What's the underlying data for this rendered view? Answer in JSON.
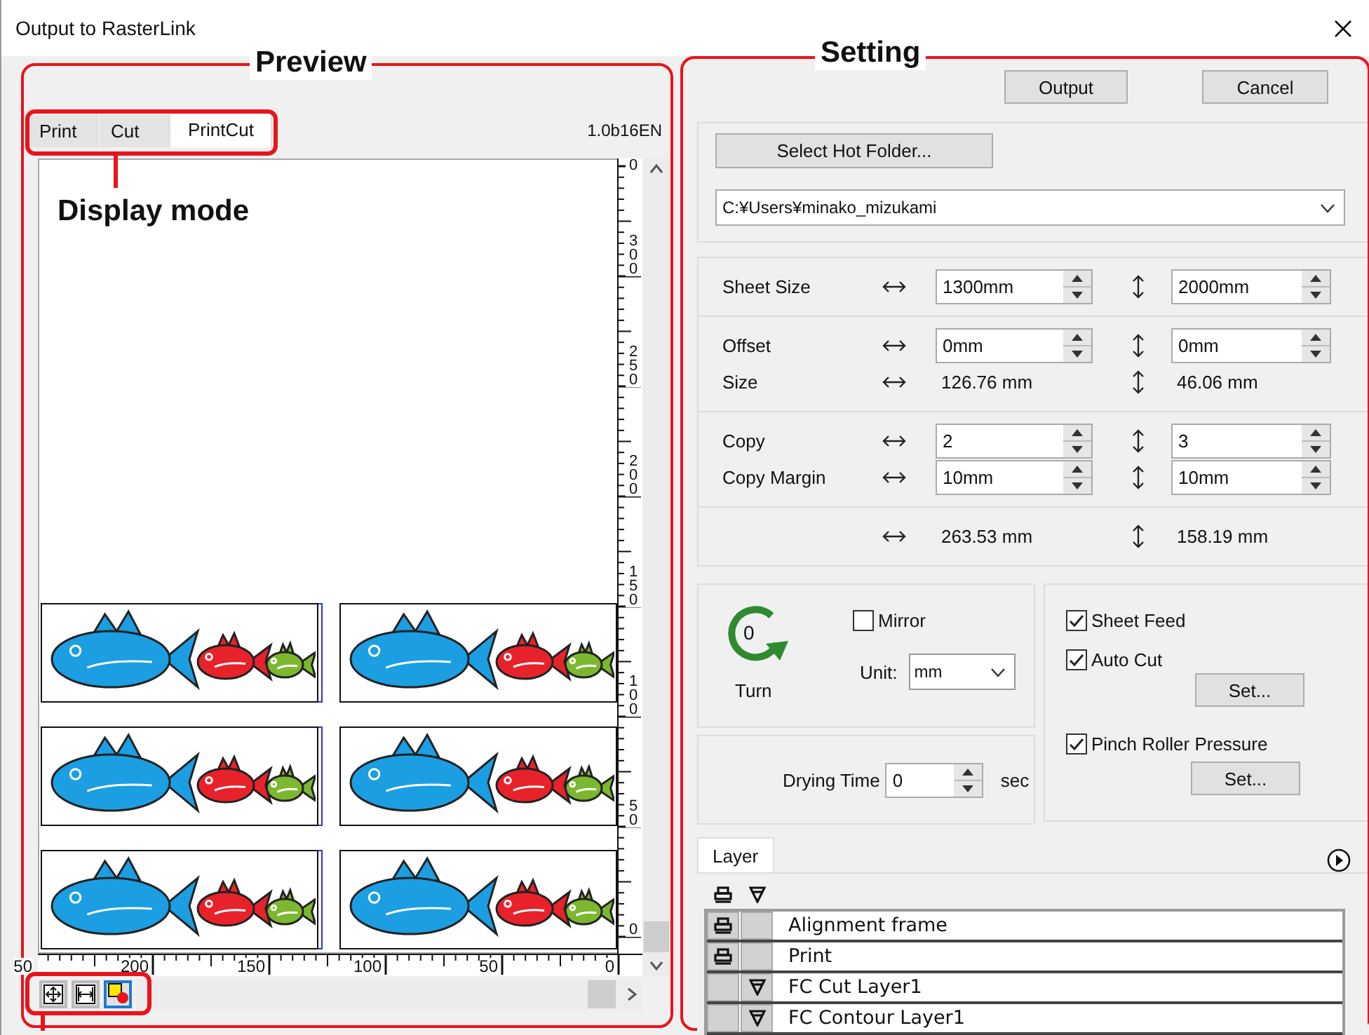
{
  "window": {
    "title": "Output to RasterLink"
  },
  "annotations": {
    "preview": "Preview",
    "setting": "Setting",
    "display_mode": "Display mode"
  },
  "preview": {
    "tabs": [
      {
        "label": "Print",
        "selected": false
      },
      {
        "label": "Cut",
        "selected": false
      },
      {
        "label": "PrintCut",
        "selected": true
      }
    ],
    "version": "1.0b16EN",
    "vertical_ruler": [
      "0",
      "300",
      "250",
      "200",
      "150",
      "100",
      "50",
      "0"
    ],
    "horizontal_ruler": [
      "50",
      "200",
      "150",
      "100",
      "50",
      "0"
    ],
    "view_buttons": [
      {
        "kind": "fit",
        "selected": false
      },
      {
        "kind": "width",
        "selected": false
      },
      {
        "kind": "color",
        "selected": true
      }
    ]
  },
  "setting": {
    "buttons": [
      "Output",
      "Cancel"
    ],
    "hot_folder_button": "Select Hot Folder...",
    "hot_folder_path": "C:¥Users¥minako_mizukami",
    "sheet_groups": [
      [
        {
          "kind": "field",
          "label": "Sheet Size",
          "h": "1300mm",
          "v": "2000mm"
        }
      ],
      [
        {
          "kind": "field",
          "label": "Offset",
          "h": "0mm",
          "v": "0mm"
        },
        {
          "kind": "text",
          "label": "Size",
          "h": "126.76 mm",
          "v": "46.06 mm"
        }
      ],
      [
        {
          "kind": "field",
          "label": "Copy",
          "h": "2",
          "v": "3"
        },
        {
          "kind": "field",
          "label": "Copy Margin",
          "h": "10mm",
          "v": "10mm"
        }
      ],
      [
        {
          "kind": "text",
          "h": "263.53 mm",
          "v": "158.19 mm"
        }
      ]
    ],
    "turn": {
      "value": "0",
      "label": "Turn"
    },
    "mirror": {
      "label": "Mirror",
      "checked": false
    },
    "unit": {
      "label": "Unit:",
      "value": "mm"
    },
    "drying_time": {
      "label": "Drying Time",
      "value": "0",
      "unit": "sec"
    },
    "options": [
      {
        "label": "Sheet Feed",
        "checked": true
      },
      {
        "label": "Auto Cut",
        "checked": true,
        "button": "Set..."
      },
      {
        "label": "Pinch Roller Pressure",
        "checked": true,
        "button": "Set..."
      }
    ],
    "layer": {
      "tab": "Layer",
      "rows": [
        {
          "name": "Alignment frame",
          "print": true,
          "cut": false
        },
        {
          "name": "Print",
          "print": true,
          "cut": false
        },
        {
          "name": "FC Cut Layer1",
          "print": false,
          "cut": true
        },
        {
          "name": "FC Contour Layer1",
          "print": false,
          "cut": true
        }
      ]
    }
  }
}
